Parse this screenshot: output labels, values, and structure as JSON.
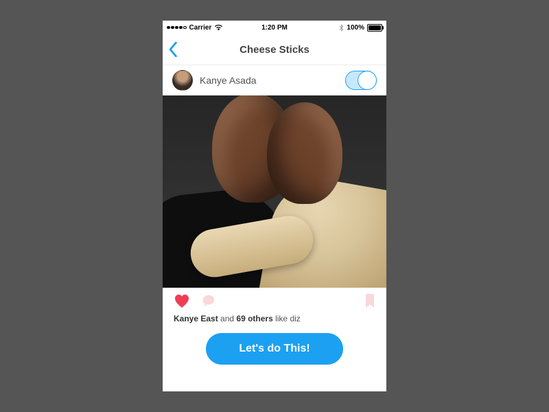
{
  "status_bar": {
    "signal_filled_dots": 4,
    "signal_total_dots": 5,
    "carrier": "Carrier",
    "time": "1:20 PM",
    "battery_pct": "100%"
  },
  "nav": {
    "title": "Cheese Sticks"
  },
  "profile": {
    "name": "Kanye Asada",
    "toggle_on": true
  },
  "actions": {
    "heart_active": true
  },
  "likes": {
    "lead_user": "Kanye East",
    "mid_text": " and ",
    "others_count": "69 others",
    "trailing": " like diz"
  },
  "cta": {
    "label": "Let's do This!"
  },
  "colors": {
    "accent": "#1ca0f2",
    "heart": "#ef3d56",
    "faded_pink": "#fad7d9"
  }
}
